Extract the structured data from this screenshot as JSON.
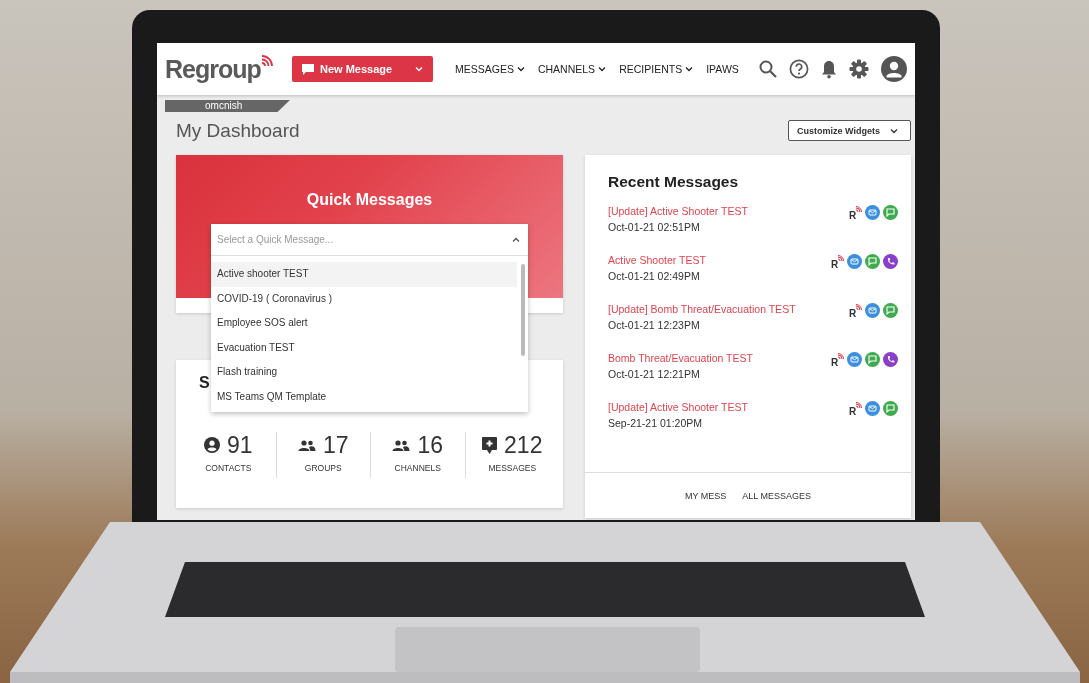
{
  "topbar": {
    "logo": "Regroup",
    "new_message_button": "New Message",
    "nav": [
      {
        "label": "MESSAGES",
        "dropdown": true
      },
      {
        "label": "CHANNELS",
        "dropdown": true
      },
      {
        "label": "RECIPIENTS",
        "dropdown": true
      },
      {
        "label": "IPAWS",
        "dropdown": false
      }
    ]
  },
  "user_tab": "omcnish",
  "page_title": "My Dashboard",
  "customize_button": "Customize Widgets",
  "quick_messages": {
    "title": "Quick Messages",
    "placeholder": "Select a Quick Message...",
    "options": [
      {
        "label": "Active shooter TEST",
        "selected": true
      },
      {
        "label": "COVID-19 ( Coronavirus )",
        "selected": false
      },
      {
        "label": "Employee SOS alert",
        "selected": false
      },
      {
        "label": "Evacuation TEST",
        "selected": false
      },
      {
        "label": "Flash training",
        "selected": false
      },
      {
        "label": "MS Teams QM Template",
        "selected": false
      }
    ]
  },
  "summary": {
    "title": "S",
    "stats": [
      {
        "kind": "contacts",
        "value": "91",
        "label": "CONTACTS"
      },
      {
        "kind": "groups",
        "value": "17",
        "label": "GROUPS"
      },
      {
        "kind": "channels",
        "value": "16",
        "label": "CHANNELS"
      },
      {
        "kind": "messages",
        "value": "212",
        "label": "MESSAGES"
      }
    ]
  },
  "recent_messages": {
    "title": "Recent Messages",
    "items": [
      {
        "title": "[Update] Active Shooter TEST",
        "date": "Oct-01-21 02:51PM",
        "channels": [
          {
            "kind": "ipaws",
            "label": "R"
          },
          {
            "kind": "email"
          },
          {
            "kind": "sms"
          }
        ]
      },
      {
        "title": "Active Shooter TEST",
        "date": "Oct-01-21 02:49PM",
        "channels": [
          {
            "kind": "ipaws",
            "label": "R"
          },
          {
            "kind": "email"
          },
          {
            "kind": "sms"
          },
          {
            "kind": "voice"
          }
        ]
      },
      {
        "title": "[Update] Bomb Threat/Evacuation TEST",
        "date": "Oct-01-21 12:23PM",
        "channels": [
          {
            "kind": "ipaws",
            "label": "R"
          },
          {
            "kind": "email"
          },
          {
            "kind": "sms"
          }
        ]
      },
      {
        "title": "Bomb Threat/Evacuation TEST",
        "date": "Oct-01-21 12:21PM",
        "channels": [
          {
            "kind": "ipaws",
            "label": "R"
          },
          {
            "kind": "email"
          },
          {
            "kind": "sms"
          },
          {
            "kind": "voice"
          }
        ]
      },
      {
        "title": "[Update] Active Shooter TEST",
        "date": "Sep-21-21 01:20PM",
        "channels": [
          {
            "kind": "ipaws",
            "label": "R"
          },
          {
            "kind": "email"
          },
          {
            "kind": "sms"
          }
        ]
      }
    ],
    "footer_links": [
      "MY MESS",
      "ALL MESSAGES"
    ]
  }
}
